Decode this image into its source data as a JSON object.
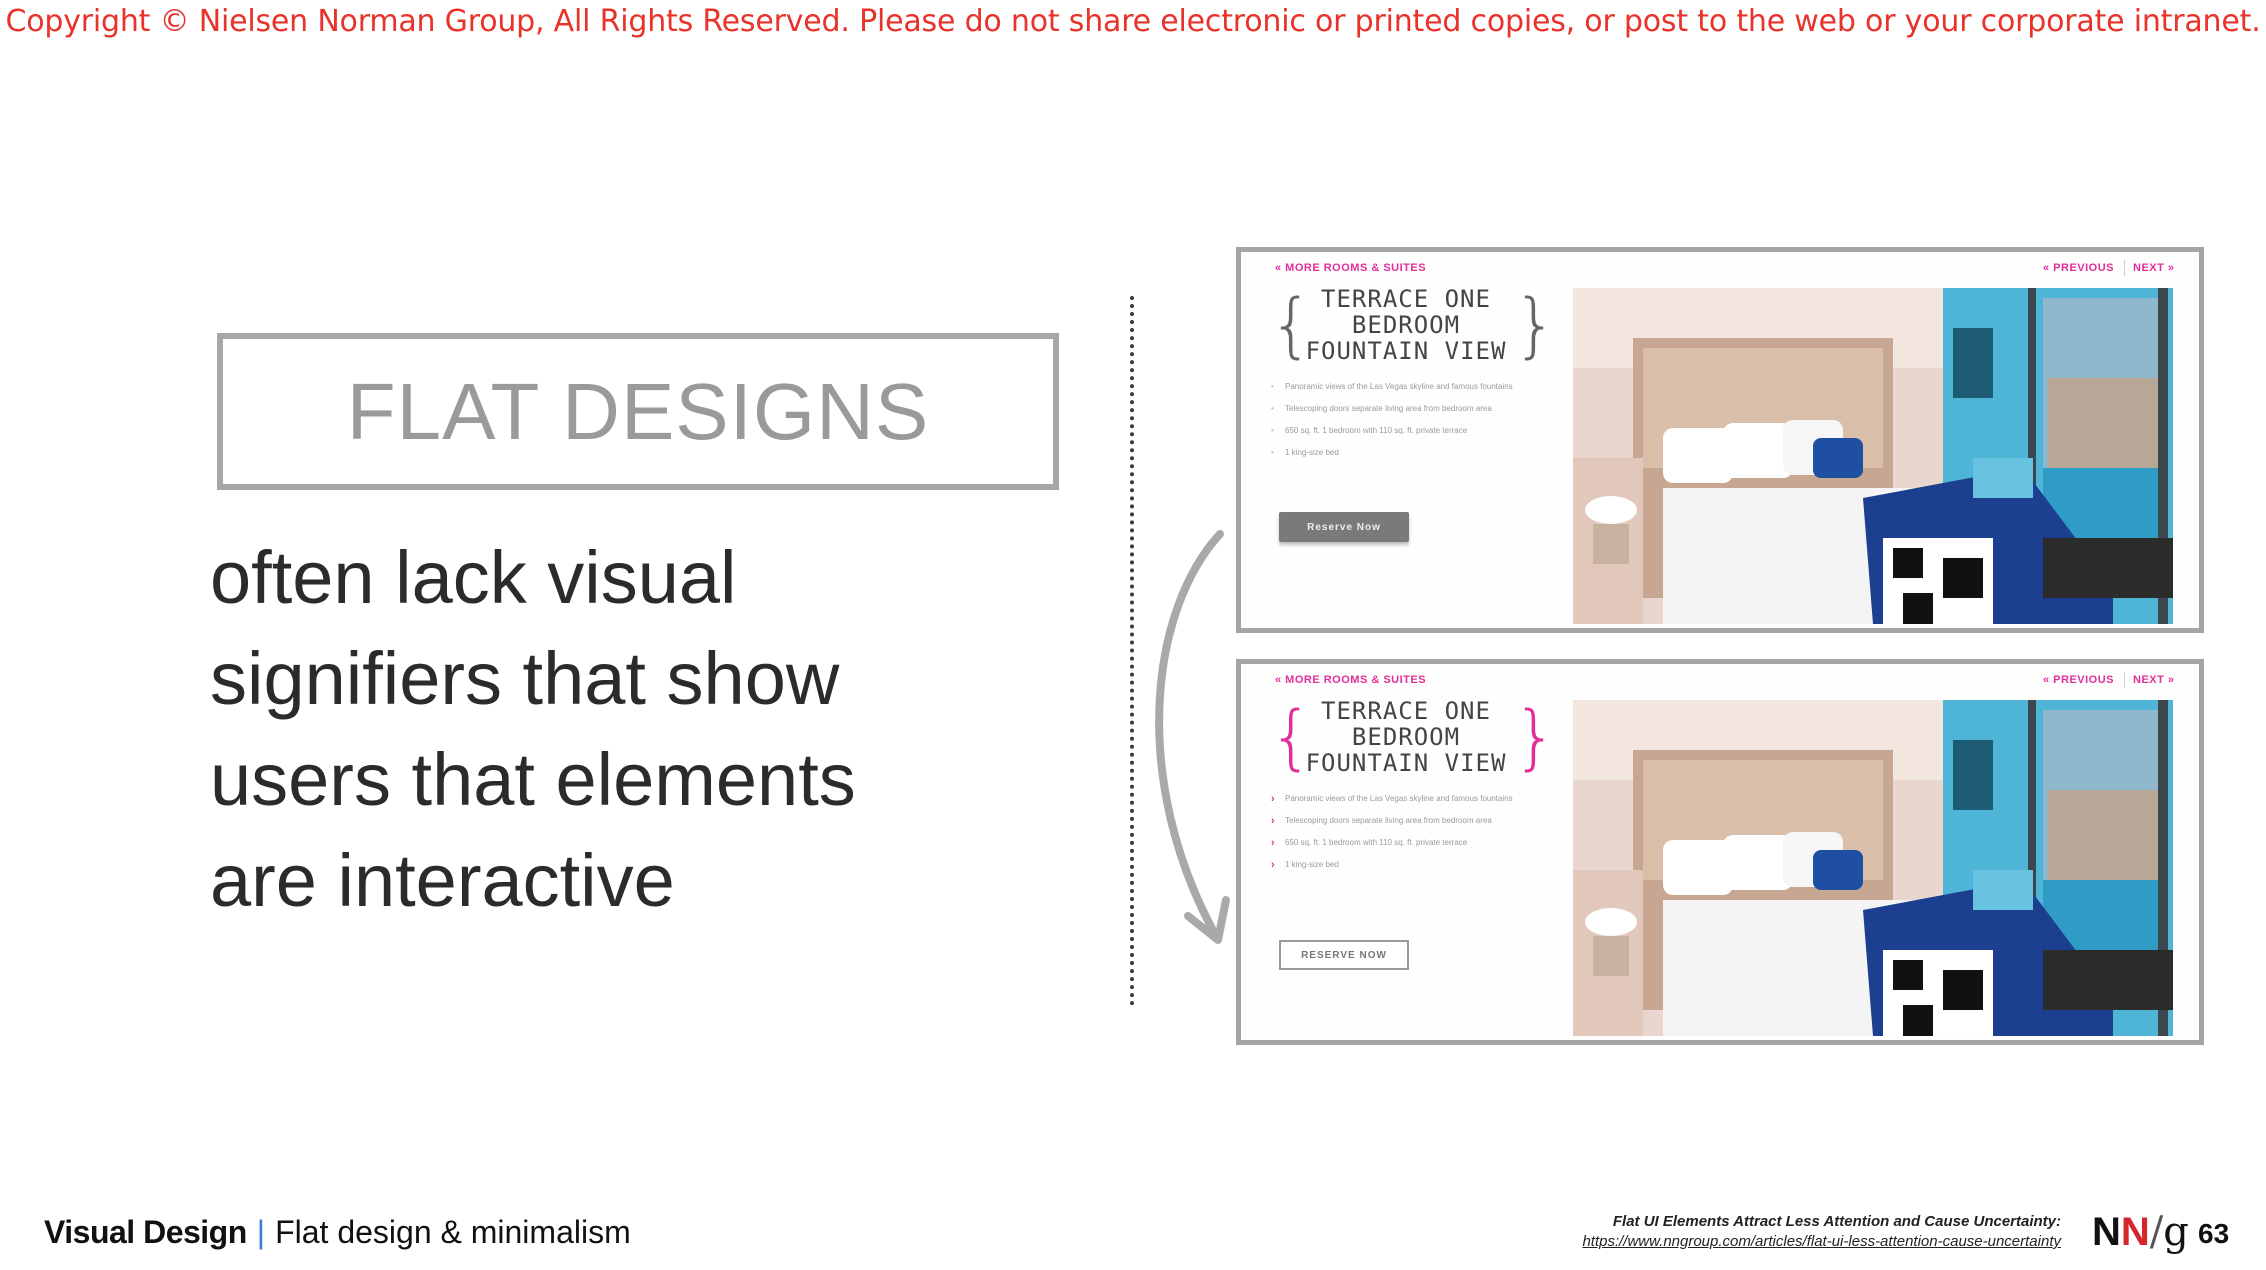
{
  "copyright": "Copyright © Nielsen Norman Group, All Rights Reserved. Please do not share electronic or printed copies, or post to the web or your corporate intranet.",
  "heading": "FLAT DESIGNS",
  "body_lines": [
    "often lack visual",
    "signifiers that show",
    "users that elements",
    "are interactive"
  ],
  "panels": [
    {
      "nav_back": "« MORE ROOMS & SUITES",
      "nav_prev": "« PREVIOUS",
      "nav_next": "NEXT »",
      "title_lines": [
        "TERRACE ONE",
        "BEDROOM",
        "FOUNTAIN VIEW"
      ],
      "features": [
        "Panoramic views of the Las Vegas skyline and famous fountains",
        "Telescoping doors separate living area from bedroom area",
        "650 sq. ft. 1 bedroom with 110 sq. ft. private terrace",
        "1 king-size bed"
      ],
      "button": "Reserve Now"
    },
    {
      "nav_back": "« MORE ROOMS & SUITES",
      "nav_prev": "« PREVIOUS",
      "nav_next": "NEXT »",
      "title_lines": [
        "TERRACE ONE",
        "BEDROOM",
        "FOUNTAIN VIEW"
      ],
      "features": [
        "Panoramic views of the Las Vegas skyline and famous fountains",
        "Telescoping doors separate living area from bedroom area",
        "650 sq. ft. 1 bedroom with 110 sq. ft. private terrace",
        "1 king-size bed"
      ],
      "button": "RESERVE NOW"
    }
  ],
  "footer": {
    "section": "Visual Design",
    "separator": "|",
    "topic": "Flat design & minimalism",
    "citation_title": "Flat UI Elements Attract Less Attention and Cause Uncertainty:",
    "citation_url": "https://www.nngroup.com/articles/flat-ui-less-attention-cause-uncertainty",
    "logo_n1": "N",
    "logo_n2": "N",
    "logo_slash": "/",
    "logo_g": "g",
    "page_number": "63"
  },
  "colors": {
    "copyright": "#e8322a",
    "accent_pink": "#e02f9a",
    "logo_red": "#d5262c",
    "pipe_blue": "#3c7bd6"
  },
  "icons": [
    "curved-arrow-down-icon"
  ]
}
